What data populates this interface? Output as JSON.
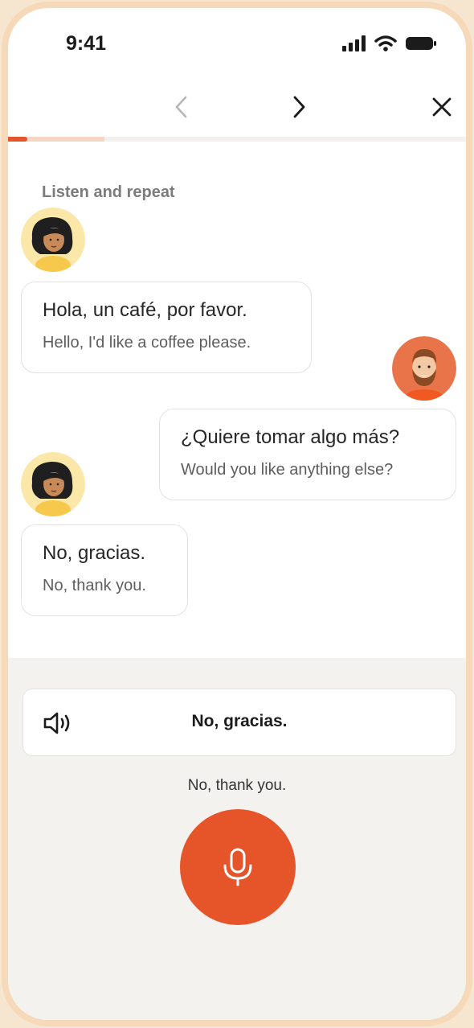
{
  "status_bar": {
    "time": "9:41"
  },
  "nav": {
    "back_icon": "chevron-left-icon",
    "forward_icon": "chevron-right-icon",
    "close_icon": "close-icon"
  },
  "progress": {
    "fraction": 0.21
  },
  "lesson": {
    "instruction": "Listen and repeat",
    "messages": [
      {
        "speaker": "woman",
        "es": "Hola, un café, por favor.",
        "en": "Hello, I'd like a coffee please."
      },
      {
        "speaker": "man",
        "es": "¿Quiere tomar algo más?",
        "en": "Would you like anything else?"
      },
      {
        "speaker": "woman",
        "es": "No, gracias.",
        "en": "No, thank you."
      }
    ]
  },
  "practice": {
    "phrase": "No, gracias.",
    "translation": "No, thank you.",
    "speaker_icon": "speaker-icon",
    "mic_icon": "microphone-icon",
    "accent_color": "#e6552a"
  }
}
